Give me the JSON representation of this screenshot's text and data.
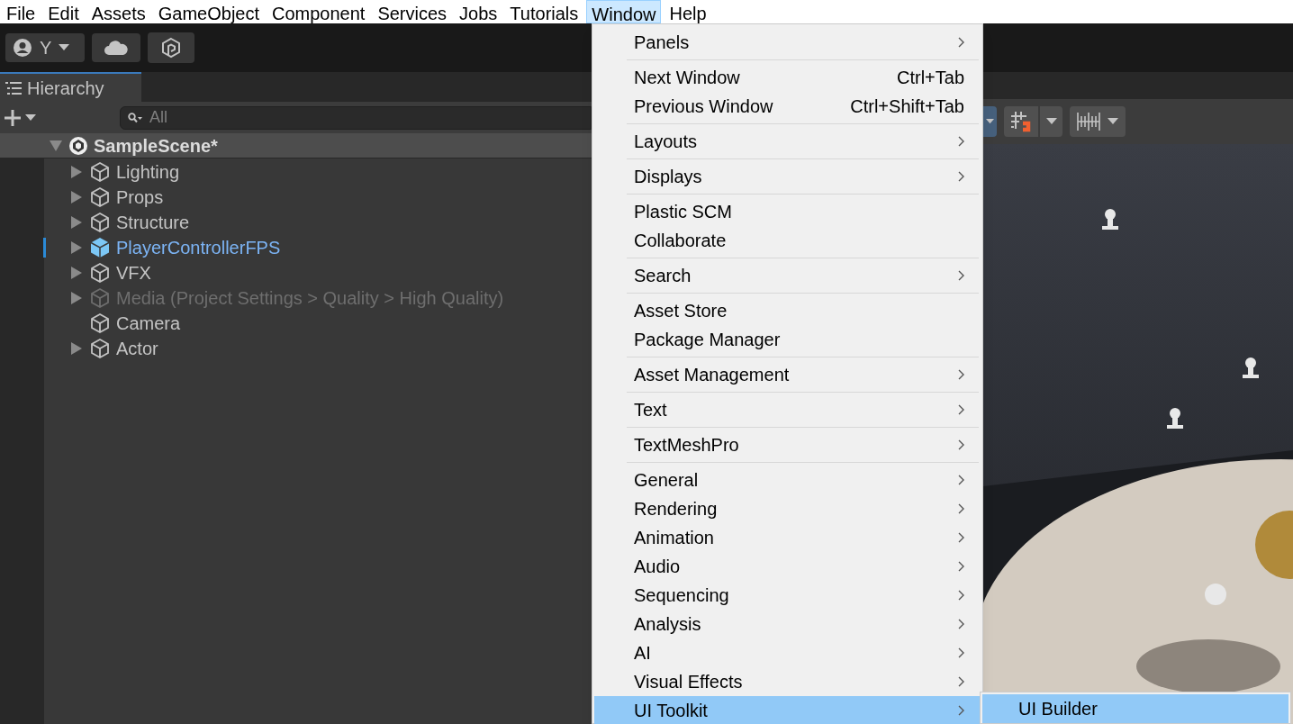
{
  "menubar": [
    {
      "label": "File",
      "selected": false
    },
    {
      "label": "Edit",
      "selected": false
    },
    {
      "label": "Assets",
      "selected": false
    },
    {
      "label": "GameObject",
      "selected": false
    },
    {
      "label": "Component",
      "selected": false
    },
    {
      "label": "Services",
      "selected": false
    },
    {
      "label": "Jobs",
      "selected": false
    },
    {
      "label": "Tutorials",
      "selected": false
    },
    {
      "label": "Window",
      "selected": true
    },
    {
      "label": "Help",
      "selected": false
    }
  ],
  "toolbar": {
    "account_label": "Y"
  },
  "hierarchy": {
    "tab": "Hierarchy",
    "search": {
      "placeholder": "All"
    },
    "scene": {
      "name": "SampleScene*",
      "expanded": true,
      "children": [
        {
          "name": "Lighting",
          "kind": "object",
          "expandable": true,
          "disabled": false
        },
        {
          "name": "Props",
          "kind": "object",
          "expandable": true,
          "disabled": false
        },
        {
          "name": "Structure",
          "kind": "object",
          "expandable": true,
          "disabled": false
        },
        {
          "name": "PlayerControllerFPS",
          "kind": "prefab",
          "expandable": true,
          "disabled": false
        },
        {
          "name": "VFX",
          "kind": "object",
          "expandable": true,
          "disabled": false
        },
        {
          "name": "Media (Project Settings > Quality > High Quality)",
          "kind": "object",
          "expandable": true,
          "disabled": true
        },
        {
          "name": "Camera",
          "kind": "object",
          "expandable": false,
          "disabled": false
        },
        {
          "name": "Actor",
          "kind": "object",
          "expandable": true,
          "disabled": false
        }
      ]
    }
  },
  "window_menu": {
    "groups": [
      [
        {
          "label": "Panels",
          "submenu": true,
          "selected": false
        }
      ],
      [
        {
          "label": "Next Window",
          "shortcut": "Ctrl+Tab",
          "submenu": false,
          "selected": false
        },
        {
          "label": "Previous Window",
          "shortcut": "Ctrl+Shift+Tab",
          "submenu": false,
          "selected": false
        }
      ],
      [
        {
          "label": "Layouts",
          "submenu": true,
          "selected": false
        }
      ],
      [
        {
          "label": "Displays",
          "submenu": true,
          "selected": false
        }
      ],
      [
        {
          "label": "Plastic SCM",
          "submenu": false,
          "selected": false
        },
        {
          "label": "Collaborate",
          "submenu": false,
          "selected": false
        }
      ],
      [
        {
          "label": "Search",
          "submenu": true,
          "selected": false
        }
      ],
      [
        {
          "label": "Asset Store",
          "submenu": false,
          "selected": false
        },
        {
          "label": "Package Manager",
          "submenu": false,
          "selected": false
        }
      ],
      [
        {
          "label": "Asset Management",
          "submenu": true,
          "selected": false
        }
      ],
      [
        {
          "label": "Text",
          "submenu": true,
          "selected": false
        }
      ],
      [
        {
          "label": "TextMeshPro",
          "submenu": true,
          "selected": false
        }
      ],
      [
        {
          "label": "General",
          "submenu": true,
          "selected": false
        },
        {
          "label": "Rendering",
          "submenu": true,
          "selected": false
        },
        {
          "label": "Animation",
          "submenu": true,
          "selected": false
        },
        {
          "label": "Audio",
          "submenu": true,
          "selected": false
        },
        {
          "label": "Sequencing",
          "submenu": true,
          "selected": false
        },
        {
          "label": "Analysis",
          "submenu": true,
          "selected": false
        },
        {
          "label": "AI",
          "submenu": true,
          "selected": false
        },
        {
          "label": "Visual Effects",
          "submenu": true,
          "selected": false
        },
        {
          "label": "UI Toolkit",
          "submenu": true,
          "selected": true
        }
      ]
    ]
  },
  "submenu": {
    "items": [
      {
        "label": "UI Builder",
        "selected": true
      }
    ]
  }
}
